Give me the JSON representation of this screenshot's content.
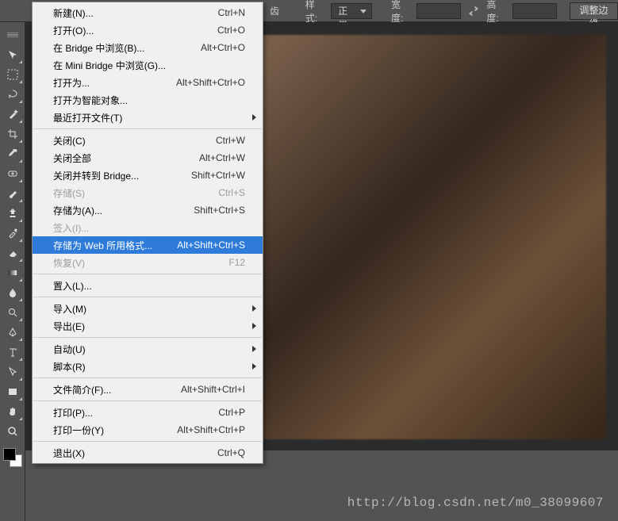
{
  "options_bar": {
    "snap_label": "齿",
    "style_label": "样式:",
    "style_value": "正常",
    "width_label": "宽度:",
    "width_value": "",
    "height_label": "高度:",
    "height_value": "",
    "adjust_label": "调整边缘"
  },
  "menu": {
    "items": [
      {
        "id": "new",
        "label": "新建(N)...",
        "shortcut": "Ctrl+N",
        "sub": false,
        "disabled": false,
        "after_sep": false
      },
      {
        "id": "open",
        "label": "打开(O)...",
        "shortcut": "Ctrl+O",
        "sub": false,
        "disabled": false,
        "after_sep": false
      },
      {
        "id": "browse-in-bridge",
        "label": "在 Bridge 中浏览(B)...",
        "shortcut": "Alt+Ctrl+O",
        "sub": false,
        "disabled": false,
        "after_sep": false
      },
      {
        "id": "browse-mini-bridge",
        "label": "在 Mini Bridge 中浏览(G)...",
        "shortcut": "",
        "sub": false,
        "disabled": false,
        "after_sep": false
      },
      {
        "id": "open-as",
        "label": "打开为...",
        "shortcut": "Alt+Shift+Ctrl+O",
        "sub": false,
        "disabled": false,
        "after_sep": false
      },
      {
        "id": "open-smart",
        "label": "打开为智能对象...",
        "shortcut": "",
        "sub": false,
        "disabled": false,
        "after_sep": false
      },
      {
        "id": "recent",
        "label": "最近打开文件(T)",
        "shortcut": "",
        "sub": true,
        "disabled": false,
        "after_sep": true
      },
      {
        "id": "close",
        "label": "关闭(C)",
        "shortcut": "Ctrl+W",
        "sub": false,
        "disabled": false,
        "after_sep": false
      },
      {
        "id": "close-all",
        "label": "关闭全部",
        "shortcut": "Alt+Ctrl+W",
        "sub": false,
        "disabled": false,
        "after_sep": false
      },
      {
        "id": "close-to-bridge",
        "label": "关闭并转到 Bridge...",
        "shortcut": "Shift+Ctrl+W",
        "sub": false,
        "disabled": false,
        "after_sep": false
      },
      {
        "id": "save",
        "label": "存储(S)",
        "shortcut": "Ctrl+S",
        "sub": false,
        "disabled": true,
        "after_sep": false
      },
      {
        "id": "save-as",
        "label": "存储为(A)...",
        "shortcut": "Shift+Ctrl+S",
        "sub": false,
        "disabled": false,
        "after_sep": false
      },
      {
        "id": "check-in",
        "label": "签入(I)...",
        "shortcut": "",
        "sub": false,
        "disabled": true,
        "after_sep": false
      },
      {
        "id": "save-for-web",
        "label": "存储为 Web 所用格式...",
        "shortcut": "Alt+Shift+Ctrl+S",
        "sub": false,
        "disabled": false,
        "after_sep": false,
        "highlight": true
      },
      {
        "id": "revert",
        "label": "恢复(V)",
        "shortcut": "F12",
        "sub": false,
        "disabled": true,
        "after_sep": true
      },
      {
        "id": "place",
        "label": "置入(L)...",
        "shortcut": "",
        "sub": false,
        "disabled": false,
        "after_sep": true
      },
      {
        "id": "import",
        "label": "导入(M)",
        "shortcut": "",
        "sub": true,
        "disabled": false,
        "after_sep": false
      },
      {
        "id": "export",
        "label": "导出(E)",
        "shortcut": "",
        "sub": true,
        "disabled": false,
        "after_sep": true
      },
      {
        "id": "automate",
        "label": "自动(U)",
        "shortcut": "",
        "sub": true,
        "disabled": false,
        "after_sep": false
      },
      {
        "id": "scripts",
        "label": "脚本(R)",
        "shortcut": "",
        "sub": true,
        "disabled": false,
        "after_sep": true
      },
      {
        "id": "file-info",
        "label": "文件简介(F)...",
        "shortcut": "Alt+Shift+Ctrl+I",
        "sub": false,
        "disabled": false,
        "after_sep": true
      },
      {
        "id": "print",
        "label": "打印(P)...",
        "shortcut": "Ctrl+P",
        "sub": false,
        "disabled": false,
        "after_sep": false
      },
      {
        "id": "print-one",
        "label": "打印一份(Y)",
        "shortcut": "Alt+Shift+Ctrl+P",
        "sub": false,
        "disabled": false,
        "after_sep": true
      },
      {
        "id": "exit",
        "label": "退出(X)",
        "shortcut": "Ctrl+Q",
        "sub": false,
        "disabled": false,
        "after_sep": false
      }
    ]
  },
  "tools": [
    "move",
    "marquee",
    "lasso",
    "magic-wand",
    "crop",
    "eyedropper",
    "healing-brush",
    "brush",
    "clone-stamp",
    "history-brush",
    "eraser",
    "gradient",
    "blur",
    "dodge",
    "pen",
    "type",
    "path-select",
    "rectangle",
    "hand",
    "zoom"
  ],
  "watermark": "http://blog.csdn.net/m0_38099607"
}
